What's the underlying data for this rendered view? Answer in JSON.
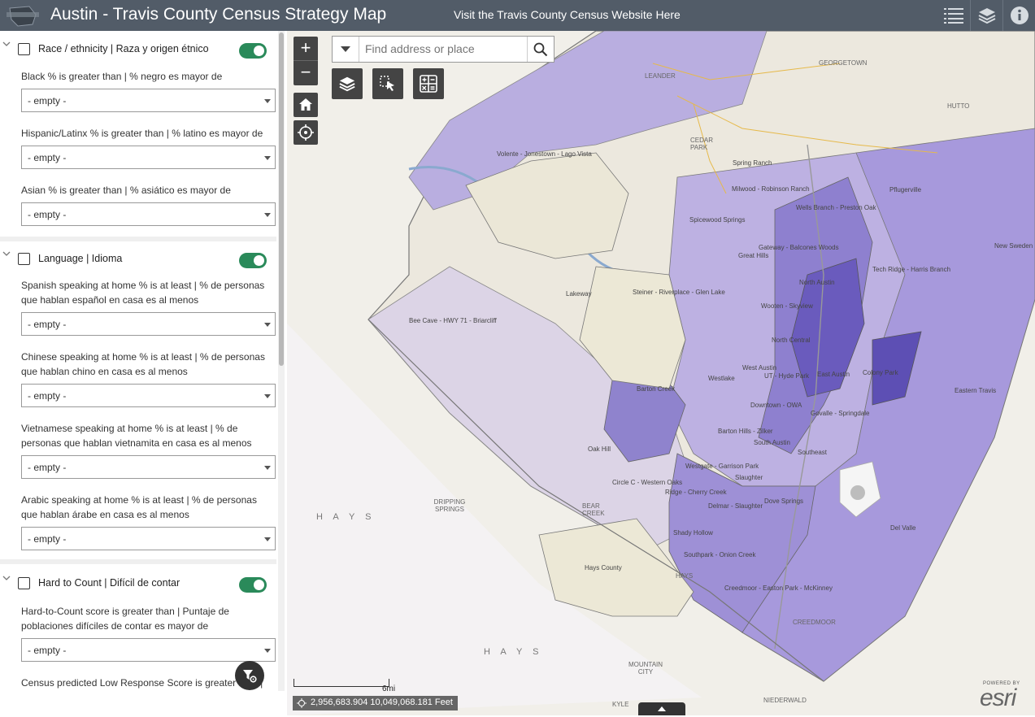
{
  "header": {
    "title": "Austin - Travis County Census Strategy Map",
    "link_label": "Visit the Travis County Census Website Here",
    "buttons": [
      "list-icon",
      "layers-icon",
      "info-icon"
    ]
  },
  "panel": {
    "sections": [
      {
        "title": "Race / ethnicity | Raza y origen étnico",
        "icon": "people-icon",
        "toggle_on": true,
        "filters": [
          {
            "label": "Black % is greater than | % negro es mayor de",
            "value": "- empty -"
          },
          {
            "label": "Hispanic/Latinx % is greater than | % latino es mayor de",
            "value": "- empty -"
          },
          {
            "label": "Asian % is greater than | % asiático es mayor de",
            "value": "- empty -"
          }
        ]
      },
      {
        "title": "Language | Idioma",
        "icon": "language-icon",
        "toggle_on": true,
        "filters": [
          {
            "label": "Spanish speaking at home % is at least | % de personas que hablan español en casa es al menos",
            "value": "- empty -"
          },
          {
            "label": "Chinese speaking at home % is at least | % de personas que hablan chino en casa es al menos",
            "value": "- empty -"
          },
          {
            "label": "Vietnamese speaking at home % is at least | % de personas que hablan vietnamita en casa es al menos",
            "value": "- empty -"
          },
          {
            "label": "Arabic speaking at home % is at least | % de personas que hablan árabe en casa es al menos",
            "value": "- empty -"
          }
        ]
      },
      {
        "title": "Hard to Count | Difícil de contar",
        "icon": "first-icon",
        "toggle_on": true,
        "filters": [
          {
            "label": "Hard-to-Count score is greater than | Puntaje de poblaciones difíciles de contar es mayor de",
            "value": "- empty -"
          },
          {
            "label": "Census predicted Low Response Score is greater than |",
            "value": ""
          }
        ]
      }
    ]
  },
  "map": {
    "search": {
      "placeholder": "Find address or place"
    },
    "zoom_in": "+",
    "zoom_out": "−",
    "scale_label": "6mi",
    "coordinates": "2,956,683.904 10,049,068.181 Feet",
    "esri_powered": "POWERED BY",
    "esri_brand": "esri",
    "labels": {
      "georgetown": "GEORGETOWN",
      "leander": "LEANDER",
      "hutto": "HUTTO",
      "cedar_park": "CEDAR PARK",
      "volente": "Volente - Jonestown - Lago Vista",
      "spring_ranch": "Spring Ranch",
      "milwood": "Milwood - Robinson Ranch",
      "wells_branch": "Wells Branch - Preston Oak",
      "pflugerville": "Pflugerville",
      "spicewood": "Spicewood Springs",
      "gateway": "Gateway - Balcones Woods",
      "great_hills": "Great Hills",
      "new_sweden": "New Sweden",
      "tech_ridge": "Tech Ridge - Harris Branch",
      "north_austin": "North Austin",
      "lakeway": "Lakeway",
      "steiner": "Steiner - Riverplace - Glen Lake",
      "bee_cave": "Bee Cave - HWY 71 - Briarcliff",
      "wooten": "Wooten - Skyview",
      "north_central": "North Central",
      "west_austin": "West Austin",
      "hyde_park": "UT - Hyde Park",
      "east_austin": "East Austin",
      "colony_park": "Colony Park",
      "eastern_travis": "Eastern Travis",
      "westlake": "Westlake",
      "barton_creek": "Barton Creek",
      "downtown": "Downtown - OWA",
      "govalle": "Govalle - Springdale",
      "barton_hills": "Barton Hills - Zilker",
      "south_austin": "South Austin",
      "southeast": "Southeast",
      "oak_hill": "Oak Hill",
      "westgate": "Westgate - Garrison Park",
      "south_lamar": "Slaughter",
      "circle_c": "Circle C - Western Oaks",
      "cherry_creek": "Ridge - Cherry Creek",
      "dove_springs": "Dove Springs",
      "delmar": "Delmar - Slaughter",
      "del_valle": "Del Valle",
      "dripping_springs": "DRIPPING SPRINGS",
      "bear_creek": "BEAR CREEK",
      "hays_county_label": "HAYS",
      "hays_county": "Hays County",
      "shady_hollow": "Shady Hollow",
      "southpark": "Southpark - Onion Creek",
      "creedmoor_area": "Creedmoor - Easton Park - McKinney",
      "creedmoor": "CREEDMOOR",
      "mountain_city": "MOUNTAIN CITY",
      "kyle": "KYLE",
      "niederwald": "NIEDERWALD",
      "hays_big": "H A Y S",
      "hays_big2": "H A Y S",
      "hays_lbl2": "HAYS"
    }
  }
}
